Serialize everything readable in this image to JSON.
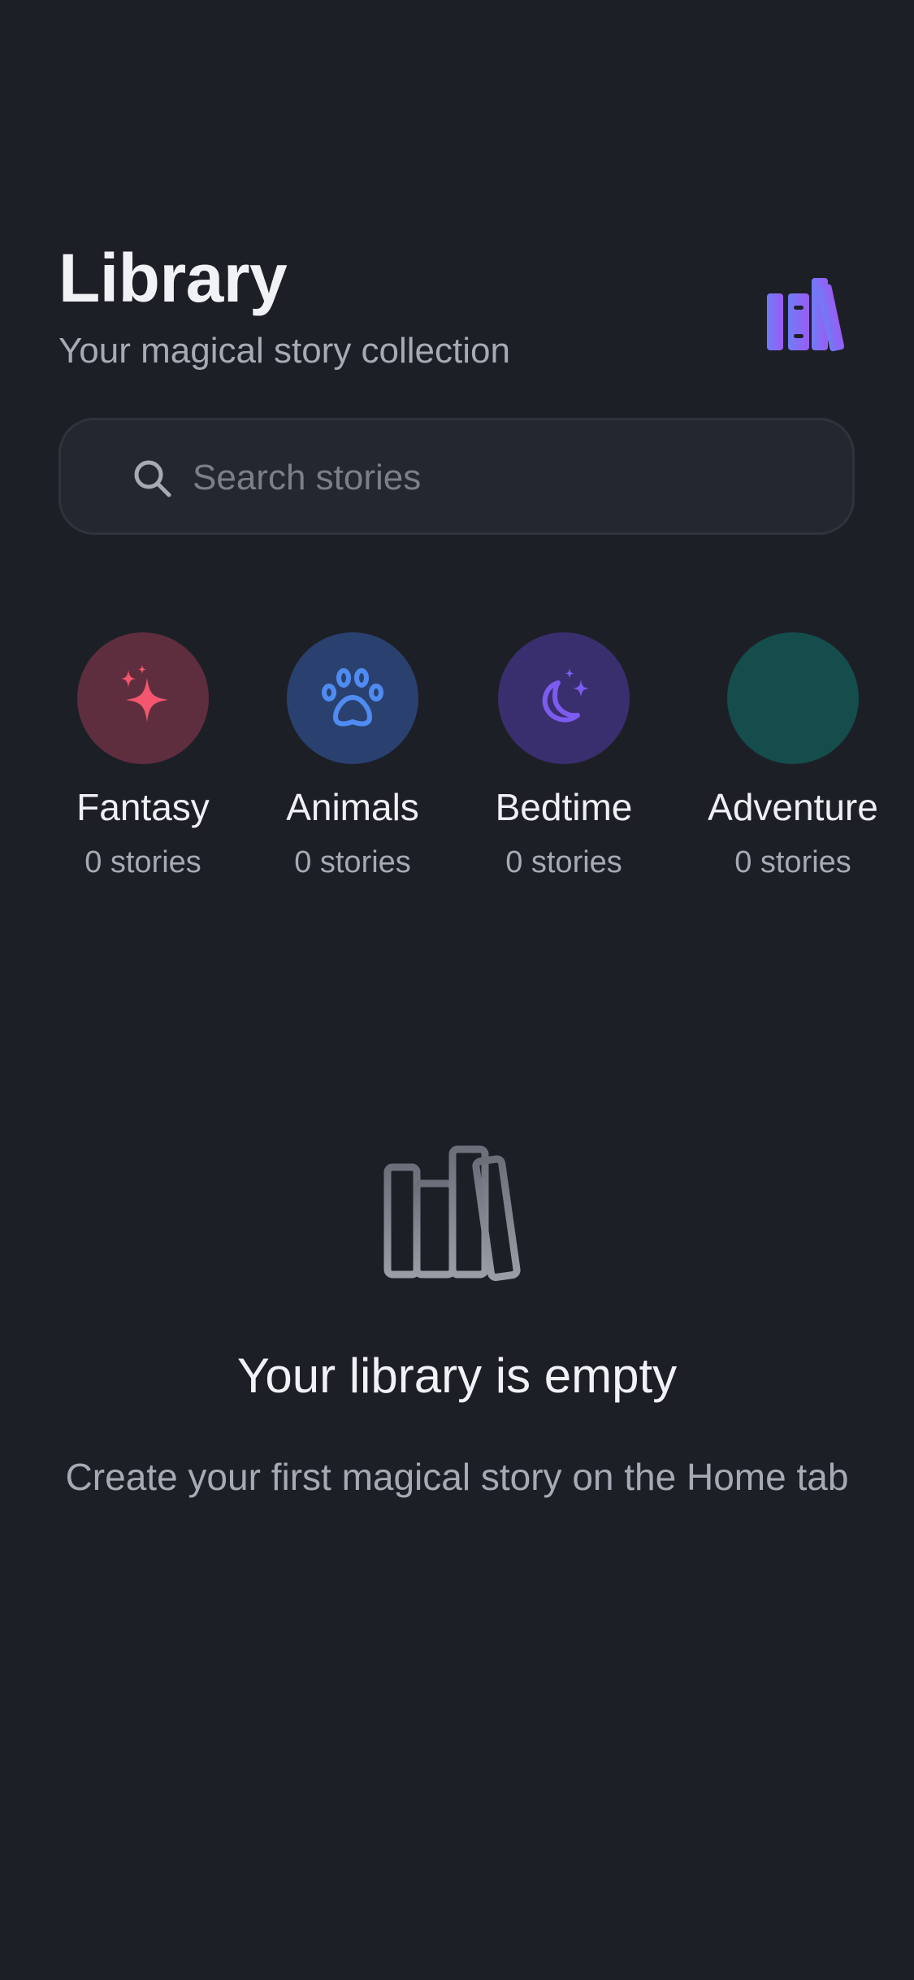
{
  "header": {
    "title": "Library",
    "subtitle": "Your magical story collection",
    "icon": "library-books-icon",
    "icon_colors": [
      "#6f7cf6",
      "#8b5cf6"
    ]
  },
  "search": {
    "placeholder": "Search stories",
    "value": "",
    "icon": "search-icon"
  },
  "categories": [
    {
      "name": "Fantasy",
      "count": "0 stories",
      "icon": "sparkles-icon",
      "bg": "#5e2e3e",
      "fg": "#f3566e"
    },
    {
      "name": "Animals",
      "count": "0 stories",
      "icon": "paw-icon",
      "bg": "#2a4170",
      "fg": "#4f8bf0"
    },
    {
      "name": "Bedtime",
      "count": "0 stories",
      "icon": "moon-stars-icon",
      "bg": "#3a2f6e",
      "fg": "#7c5cf0"
    },
    {
      "name": "Adventure",
      "count": "0 stories",
      "icon": "",
      "bg": "#144d4c",
      "fg": "#144d4c"
    }
  ],
  "empty_state": {
    "icon": "library-books-icon",
    "title": "Your library is empty",
    "text": "Create your first magical story on the Home tab"
  },
  "colors": {
    "background": "#1d1f27",
    "search_bg": "#252730",
    "text_primary": "#f1f2f6",
    "text_secondary": "#a7aab4"
  }
}
